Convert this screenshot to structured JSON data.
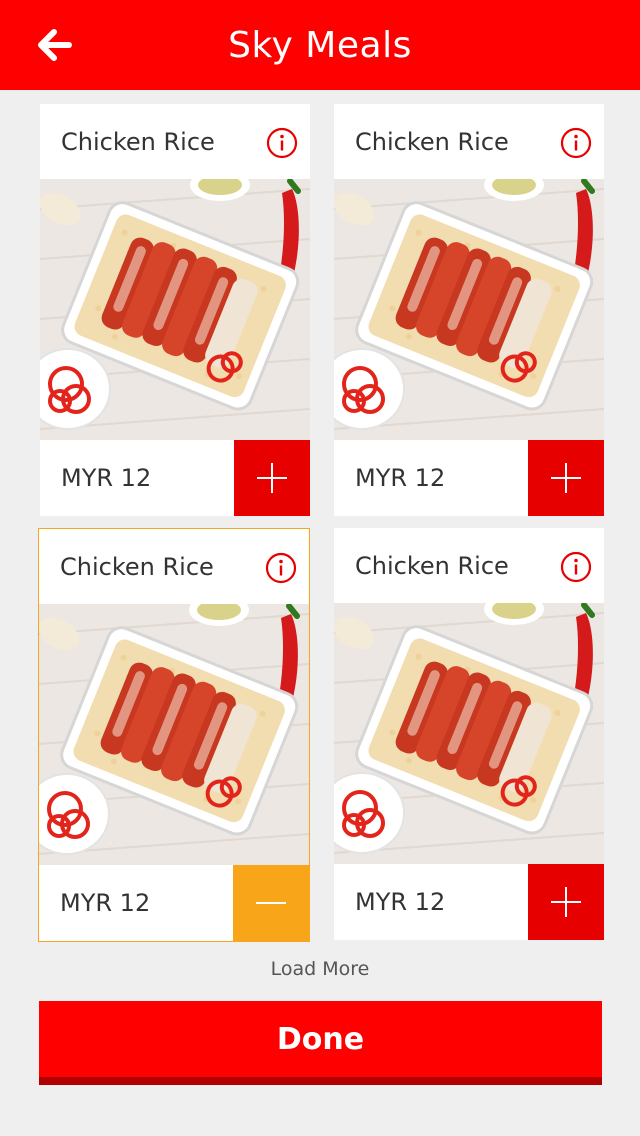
{
  "header": {
    "title": "Sky Meals",
    "back_icon": "back-arrow-icon"
  },
  "meals": [
    {
      "name": "Chicken Rice",
      "price": "MYR 12",
      "action": "add",
      "selected": false
    },
    {
      "name": "Chicken Rice",
      "price": "MYR 12",
      "action": "add",
      "selected": false
    },
    {
      "name": "Chicken Rice",
      "price": "MYR 12",
      "action": "remove",
      "selected": true
    },
    {
      "name": "Chicken Rice",
      "price": "MYR 12",
      "action": "add",
      "selected": false
    }
  ],
  "load_more": "Load More",
  "done_label": "Done",
  "colors": {
    "brand_red": "#ff0000",
    "selected_orange": "#f9a51a",
    "background": "#efefef"
  }
}
